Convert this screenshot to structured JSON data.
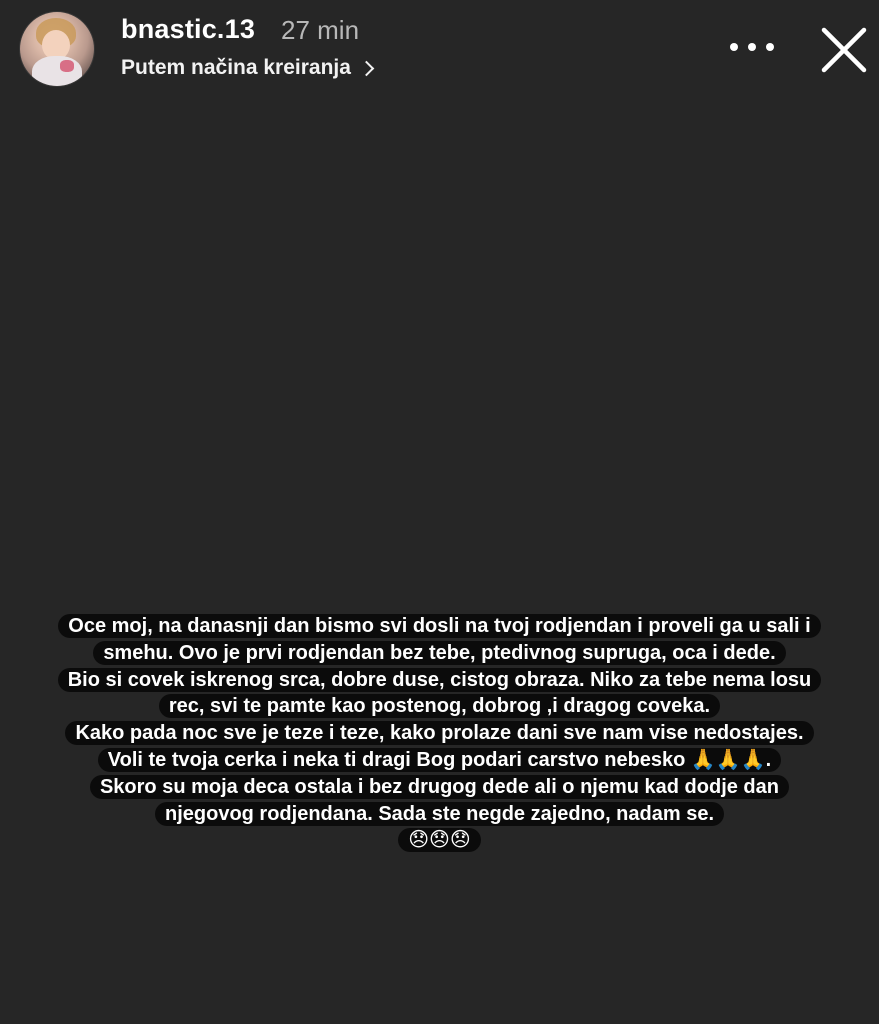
{
  "header": {
    "username": "bnastic.13",
    "time_ago": "27 min",
    "subtitle": "Putem načina kreiranja"
  },
  "icons": {
    "avatar": "profile-photo",
    "more": "more-horizontal-icon",
    "close": "close-icon",
    "subtitle_chevron": "chevron-right-icon"
  },
  "caption": {
    "lines": [
      "Oce moj, na danasnji dan bismo svi dosli na tvoj rodjendan i proveli ga u sali i",
      "smehu. Ovo je prvi rodjendan bez tebe, ptedivnog supruga, oca i dede.",
      "Bio si covek iskrenog srca, dobre duse, cistog obraza. Niko za tebe nema losu",
      "rec, svi te pamte kao postenog, dobrog ,i dragog coveka.",
      "Kako pada noc sve je teze i teze, kako prolaze dani sve nam vise nedostajes.",
      "Voli te tvoja cerka i neka ti dragi Bog podari carstvo nebesko 🙏🙏🙏.",
      "Skoro su moja deca ostala i bez drugog dede ali o njemu kad dodje dan",
      "njegovog rodjendana. Sada ste negde zajedno, nadam se.",
      "😞😞😞"
    ]
  },
  "colors": {
    "background": "#262626",
    "caption_bg": "#0b0b0b",
    "text": "#ffffff",
    "muted": "#b8b8b8"
  }
}
